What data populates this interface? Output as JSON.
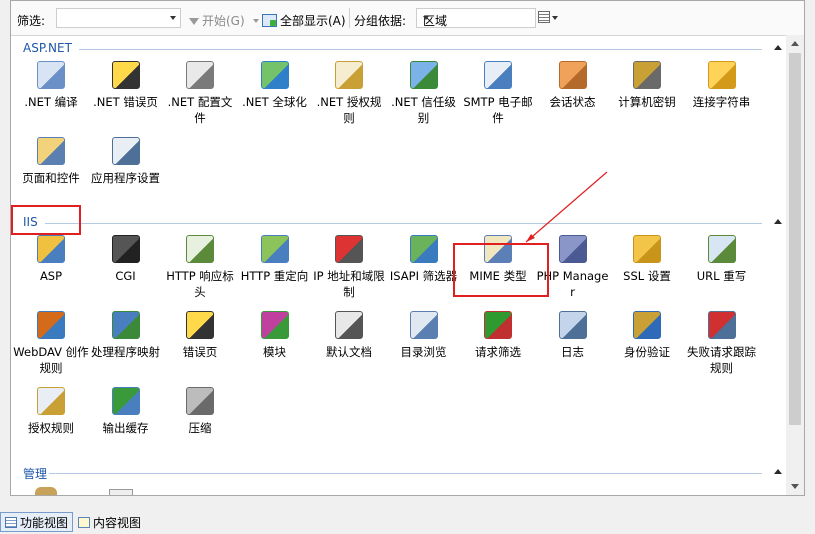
{
  "filterbar": {
    "filter_label": "筛选:",
    "start_label": "开始(G)",
    "show_all_label": "全部显示(A)",
    "group_by_label": "分组依据:",
    "group_by_value": "区域"
  },
  "sections": {
    "aspnet": {
      "title": "ASP.NET",
      "items": [
        {
          "label": ".NET 编译",
          "icon": "compile-icon"
        },
        {
          "label": ".NET 错误页",
          "icon": "error-page-icon"
        },
        {
          "label": ".NET 配置文件",
          "icon": "profile-icon"
        },
        {
          "label": ".NET 全球化",
          "icon": "globe-icon"
        },
        {
          "label": ".NET 授权规则",
          "icon": "auth-rules-icon"
        },
        {
          "label": ".NET 信任级别",
          "icon": "trust-level-icon"
        },
        {
          "label": "SMTP 电子邮件",
          "icon": "smtp-icon"
        },
        {
          "label": "会话状态",
          "icon": "session-icon"
        },
        {
          "label": "计算机密钥",
          "icon": "machine-key-icon"
        },
        {
          "label": "连接字符串",
          "icon": "connection-string-icon"
        },
        {
          "label": "页面和控件",
          "icon": "pages-controls-icon"
        },
        {
          "label": "应用程序设置",
          "icon": "app-settings-icon"
        }
      ]
    },
    "iis": {
      "title": "IIS",
      "items": [
        {
          "label": "ASP",
          "icon": "asp-icon"
        },
        {
          "label": "CGI",
          "icon": "cgi-icon"
        },
        {
          "label": "HTTP 响应标头",
          "icon": "http-headers-icon"
        },
        {
          "label": "HTTP 重定向",
          "icon": "redirect-icon"
        },
        {
          "label": "IP 地址和域限制",
          "icon": "ip-restrict-icon"
        },
        {
          "label": "ISAPI 筛选器",
          "icon": "isapi-icon"
        },
        {
          "label": "MIME 类型",
          "icon": "mime-icon"
        },
        {
          "label": "PHP Manager",
          "icon": "php-icon"
        },
        {
          "label": "SSL 设置",
          "icon": "ssl-lock-icon"
        },
        {
          "label": "URL 重写",
          "icon": "url-rewrite-icon"
        },
        {
          "label": "WebDAV 创作规则",
          "icon": "webdav-icon"
        },
        {
          "label": "处理程序映射",
          "icon": "handler-icon"
        },
        {
          "label": "错误页",
          "icon": "error-page-icon"
        },
        {
          "label": "模块",
          "icon": "modules-icon"
        },
        {
          "label": "默认文档",
          "icon": "default-doc-icon"
        },
        {
          "label": "目录浏览",
          "icon": "dir-browse-icon"
        },
        {
          "label": "请求筛选",
          "icon": "request-filter-icon"
        },
        {
          "label": "日志",
          "icon": "log-icon"
        },
        {
          "label": "身份验证",
          "icon": "authentication-icon"
        },
        {
          "label": "失败请求跟踪规则",
          "icon": "failed-request-icon"
        },
        {
          "label": "授权规则",
          "icon": "authorization-icon"
        },
        {
          "label": "输出缓存",
          "icon": "output-cache-icon"
        },
        {
          "label": "压缩",
          "icon": "compression-icon"
        }
      ]
    },
    "management": {
      "title": "管理"
    }
  },
  "bottom_tabs": {
    "features_view": "功能视图",
    "content_view": "内容视图"
  }
}
